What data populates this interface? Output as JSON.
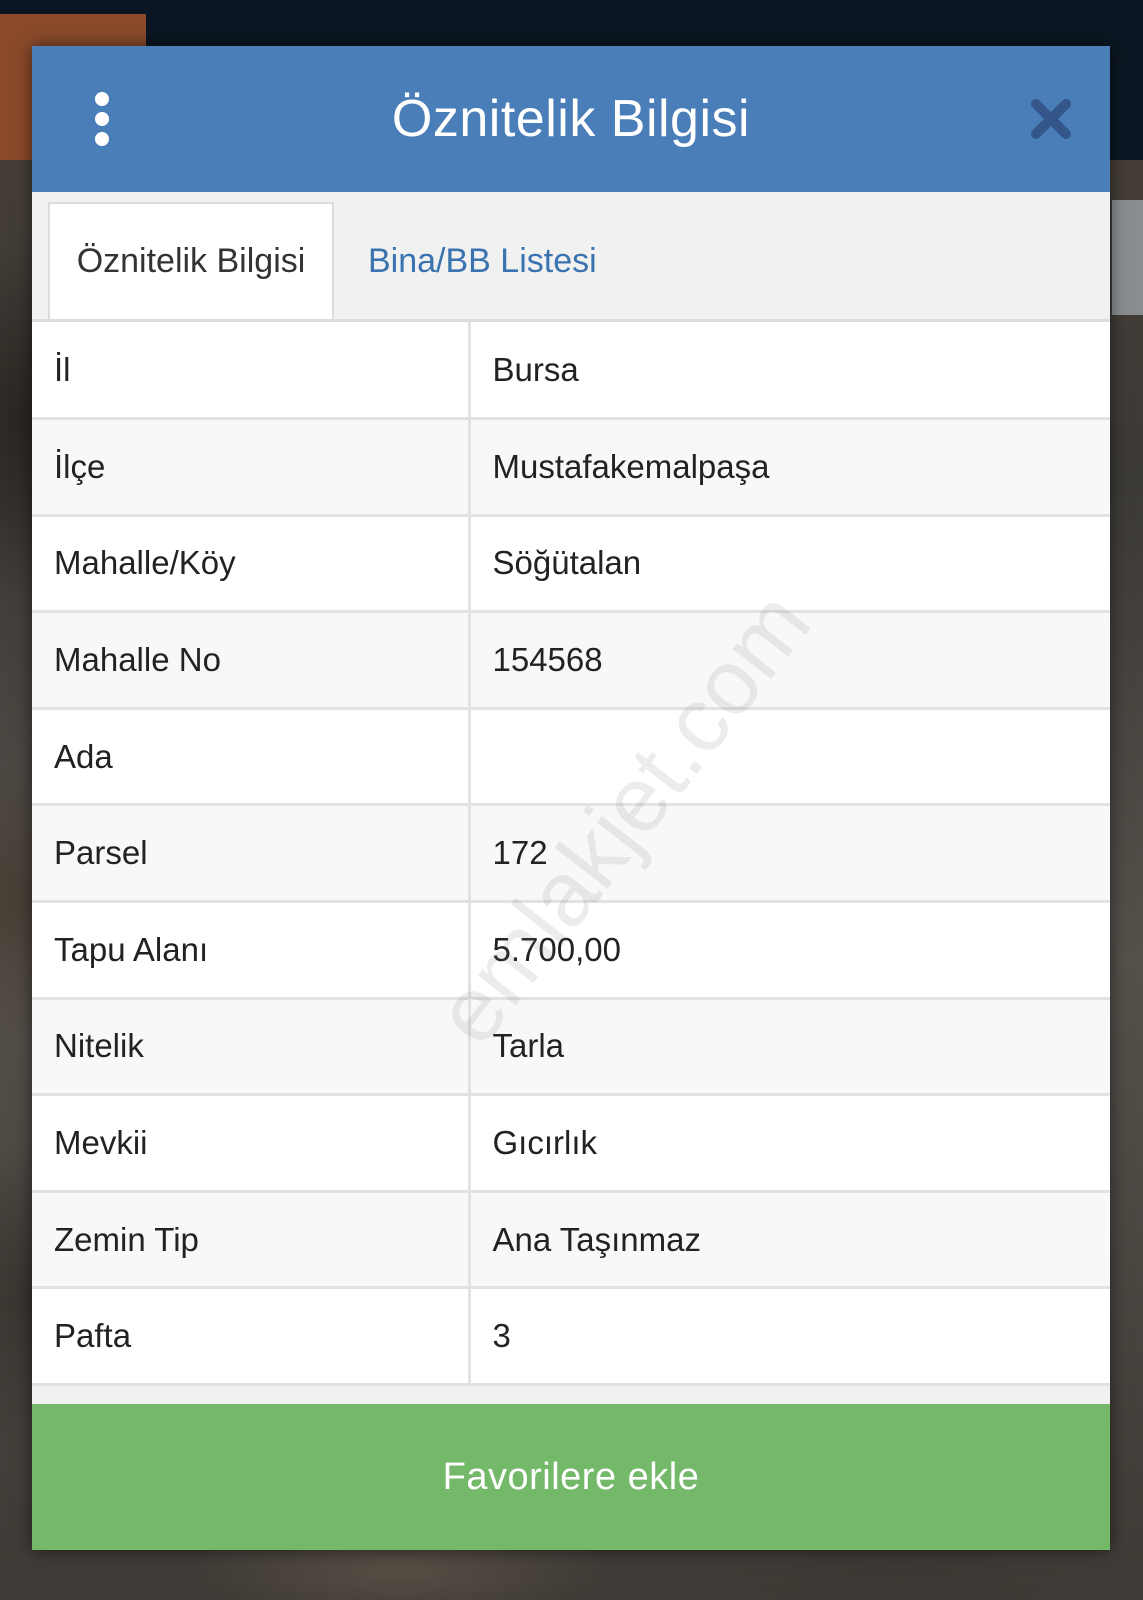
{
  "header": {
    "title": "Öznitelik Bilgisi",
    "menu_icon": "vertical-ellipsis-icon",
    "close_icon": "close-icon"
  },
  "tabs": [
    {
      "label": "Öznitelik Bilgisi",
      "active": true
    },
    {
      "label": "Bina/BB Listesi",
      "active": false
    }
  ],
  "attributes": [
    {
      "key": "İl",
      "value": "Bursa"
    },
    {
      "key": "İlçe",
      "value": "Mustafakemalpaşa"
    },
    {
      "key": "Mahalle/Köy",
      "value": "Söğütalan"
    },
    {
      "key": "Mahalle No",
      "value": "154568"
    },
    {
      "key": "Ada",
      "value": ""
    },
    {
      "key": "Parsel",
      "value": "172"
    },
    {
      "key": "Tapu Alanı",
      "value": "5.700,00"
    },
    {
      "key": "Nitelik",
      "value": "Tarla"
    },
    {
      "key": "Mevkii",
      "value": "Gıcırlık"
    },
    {
      "key": "Zemin Tip",
      "value": "Ana Taşınmaz"
    },
    {
      "key": "Pafta",
      "value": "3"
    }
  ],
  "footer": {
    "favorite_button_label": "Favorilere ekle"
  },
  "watermark": "emlakjet.com",
  "colors": {
    "header_bg": "#4a7eb9",
    "tab_link": "#3a74b0",
    "favorite_button_bg": "#74b96a"
  }
}
